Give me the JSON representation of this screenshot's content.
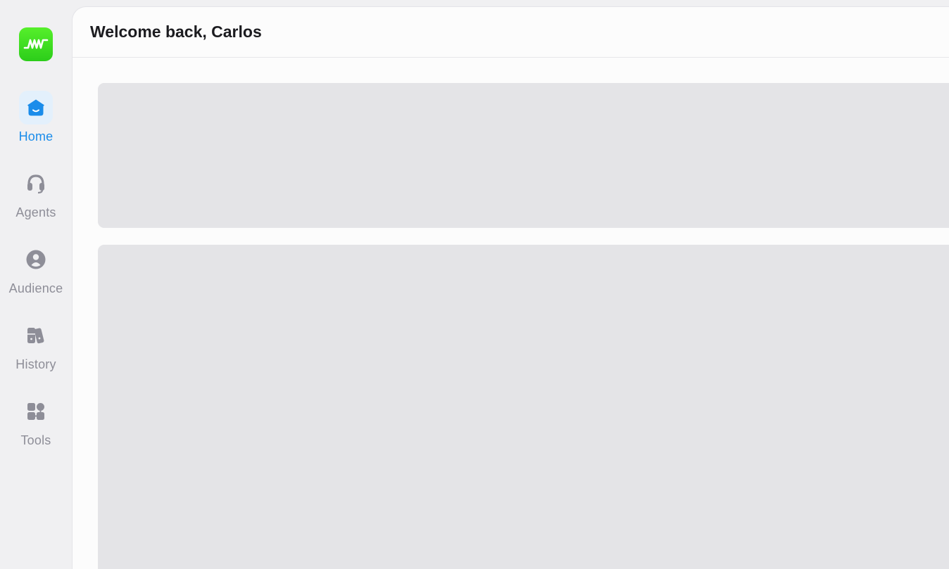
{
  "app": {
    "logo_icon": "waveform-icon",
    "logo_color": "#3ad822"
  },
  "sidebar": {
    "items": [
      {
        "label": "Home",
        "icon": "home-icon",
        "active": true
      },
      {
        "label": "Agents",
        "icon": "headset-icon",
        "active": false
      },
      {
        "label": "Audience",
        "icon": "user-circle-icon",
        "active": false
      },
      {
        "label": "History",
        "icon": "books-icon",
        "active": false
      },
      {
        "label": "Tools",
        "icon": "tools-icon",
        "active": false
      }
    ]
  },
  "header": {
    "title": "Welcome back, Carlos"
  },
  "colors": {
    "accent": "#1a8cea",
    "muted": "#8e8e98",
    "skeleton": "#e4e4e7"
  }
}
